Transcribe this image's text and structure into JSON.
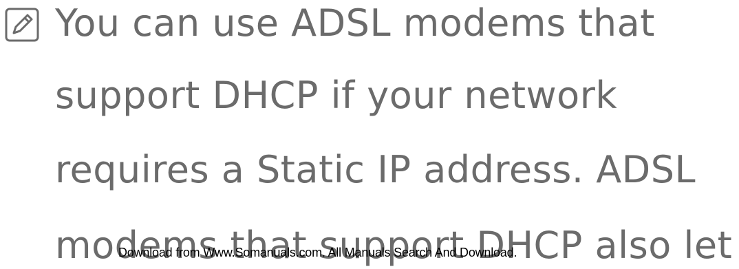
{
  "note": {
    "icon": "note-pencil-icon",
    "lines": [
      "You can use ADSL modems that",
      "support DHCP if your network",
      "requires a Static IP address. ADSL",
      "modems that support DHCP also let"
    ]
  },
  "footer": {
    "watermark_text": "Download from Www.Somanuals.com. All Manuals Search And Download."
  },
  "colors": {
    "body_text": "#6b6b6b",
    "watermark_text": "#000000"
  }
}
